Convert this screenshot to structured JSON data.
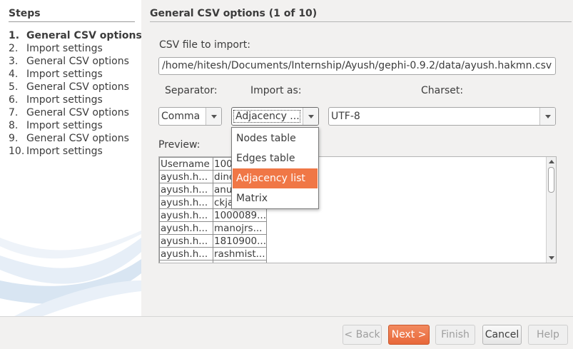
{
  "steps": {
    "title": "Steps",
    "items": [
      {
        "num": "1.",
        "label": "General CSV options",
        "current": true
      },
      {
        "num": "2.",
        "label": "Import settings"
      },
      {
        "num": "3.",
        "label": "General CSV options"
      },
      {
        "num": "4.",
        "label": "Import settings"
      },
      {
        "num": "5.",
        "label": "General CSV options"
      },
      {
        "num": "6.",
        "label": "Import settings"
      },
      {
        "num": "7.",
        "label": "General CSV options"
      },
      {
        "num": "8.",
        "label": "Import settings"
      },
      {
        "num": "9.",
        "label": "General CSV options"
      },
      {
        "num": "10.",
        "label": "Import settings"
      }
    ]
  },
  "main": {
    "title": "General CSV options (1 of 10)",
    "file_label": "CSV file to import:",
    "file_path": "/home/hitesh/Documents/Internship/Ayush/gephi-0.9.2/data/ayush.hakmn.csv",
    "separator_label": "Separator:",
    "separator_value": "Comma",
    "import_as_label": "Import as:",
    "import_as_value": "Adjacency ...",
    "charset_label": "Charset:",
    "charset_value": "UTF-8",
    "preview_label": "Preview:"
  },
  "import_as_options": [
    {
      "label": "Nodes table"
    },
    {
      "label": "Edges table"
    },
    {
      "label": "Adjacency list",
      "selected": true
    },
    {
      "label": "Matrix"
    }
  ],
  "preview_rows": [
    [
      "Username",
      "100"
    ],
    [
      "ayush.h...",
      "dine"
    ],
    [
      "ayush.h...",
      "anu"
    ],
    [
      "ayush.h...",
      "ckja"
    ],
    [
      "ayush.h...",
      "1000089..."
    ],
    [
      "ayush.h...",
      "manojrs..."
    ],
    [
      "ayush.h...",
      "1810900..."
    ],
    [
      "ayush.h...",
      "rashmist..."
    ],
    [
      "",
      ""
    ]
  ],
  "buttons": {
    "back": "< Back",
    "next": "Next >",
    "finish": "Finish",
    "cancel": "Cancel",
    "help": "Help"
  },
  "colors": {
    "accent": "#f07746",
    "panel_bg": "#ffffff",
    "window_bg": "#f2f1f0"
  }
}
